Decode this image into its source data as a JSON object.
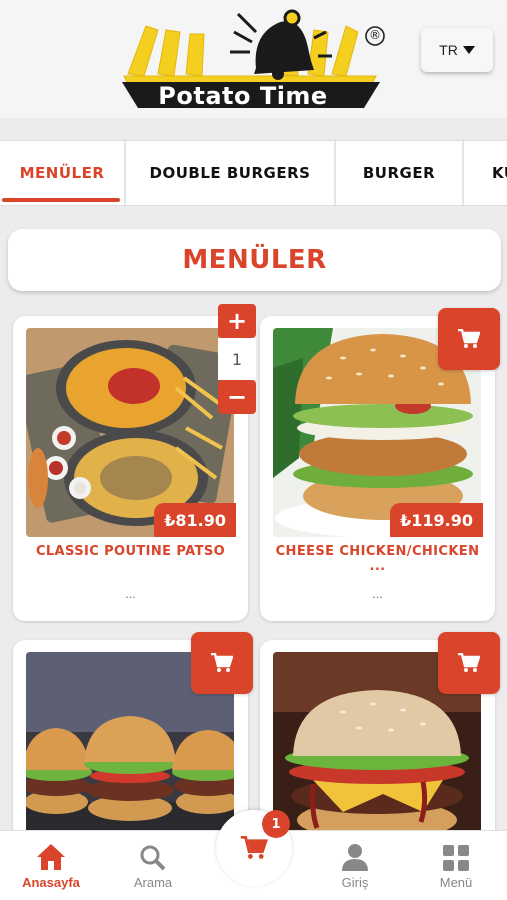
{
  "header": {
    "logo_text": "Potato Time",
    "registered_mark": "®",
    "language": "TR"
  },
  "tabs": [
    {
      "label": "MENÜLER",
      "active": true
    },
    {
      "label": "DOUBLE BURGERS",
      "active": false
    },
    {
      "label": "BURGER",
      "active": false
    },
    {
      "label": "KU",
      "active": false
    }
  ],
  "section_title": "MENÜLER",
  "products": [
    {
      "name": "CLASSIC POUTINE PATSO",
      "price": "₺81.90",
      "description": "...",
      "quantity": "1",
      "image": "fries-platter"
    },
    {
      "name": "CHEESE CHICKEN/CHICKEN ...",
      "price": "₺119.90",
      "description": "...",
      "image": "chicken-burger"
    },
    {
      "name": "",
      "price": "",
      "description": "",
      "image": "burger-trio"
    },
    {
      "name": "",
      "price": "",
      "description": "",
      "image": "cheeseburger"
    }
  ],
  "stepper": {
    "plus": "+",
    "minus": "−"
  },
  "bottom_nav": {
    "items": [
      {
        "label": "Anasayfa",
        "icon": "home-icon",
        "active": true
      },
      {
        "label": "Arama",
        "icon": "search-icon",
        "active": false
      },
      {
        "label": "Giriş",
        "icon": "user-icon",
        "active": false
      },
      {
        "label": "Menü",
        "icon": "grid-icon",
        "active": false
      }
    ],
    "cart_count": "1"
  },
  "colors": {
    "accent": "#d9442a",
    "logo_yellow": "#f5cf1f"
  }
}
